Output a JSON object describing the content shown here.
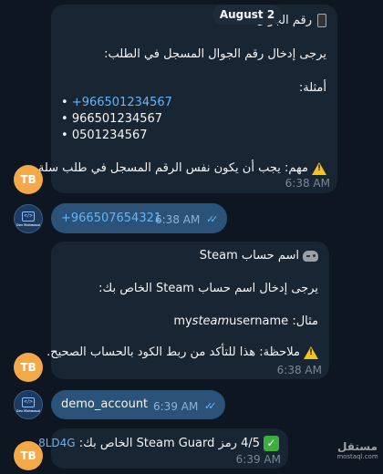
{
  "date_label": "August 2",
  "messages": {
    "m1": {
      "title": "رقم الجوال",
      "line1": "يرجى إدخال رقم الجوال المسجل في الطلب:",
      "examples_label": "أمثلة:",
      "ex1": "+966501234567",
      "ex2": "966501234567",
      "ex3": "0501234567",
      "bullet": "•",
      "note": "مهم: يجب أن يكون نفس الرقم المسجل في طلب سلة.",
      "time": "6:38 AM",
      "avatar": "TB",
      "icon": "phone-icon"
    },
    "m2": {
      "text": "+966507654321",
      "time": "6:38 AM",
      "avatar_caption": "Dev Mahmoud"
    },
    "m3": {
      "title": "اسم حساب Steam",
      "line1": "يرجى إدخال اسم حساب Steam الخاص بك:",
      "example_prefix": "مثال:",
      "example_a": "my",
      "example_b": "steam",
      "example_c": "username",
      "note": "ملاحظة: هذا للتأكد من ربط الكود بالحساب الصحيح.",
      "time": "6:38 AM",
      "avatar": "TB",
      "icon": "gamepad-icon"
    },
    "m4": {
      "text": "demo_account",
      "time": "6:39 AM",
      "avatar_caption": "Dev Mahmoud"
    },
    "m5": {
      "text": "4/5 رمز Steam Guard الخاص بك:",
      "code": "8LD4G",
      "time": "6:39 AM",
      "avatar": "TB"
    }
  },
  "watermark": {
    "arabic": "مستقل",
    "latin": "mostaql.com"
  },
  "colors": {
    "background": "#0e1621",
    "incoming_bubble": "#182533",
    "outgoing_bubble": "#2b5278",
    "link": "#6ab3f3",
    "avatar_tb": "#f4a949"
  }
}
